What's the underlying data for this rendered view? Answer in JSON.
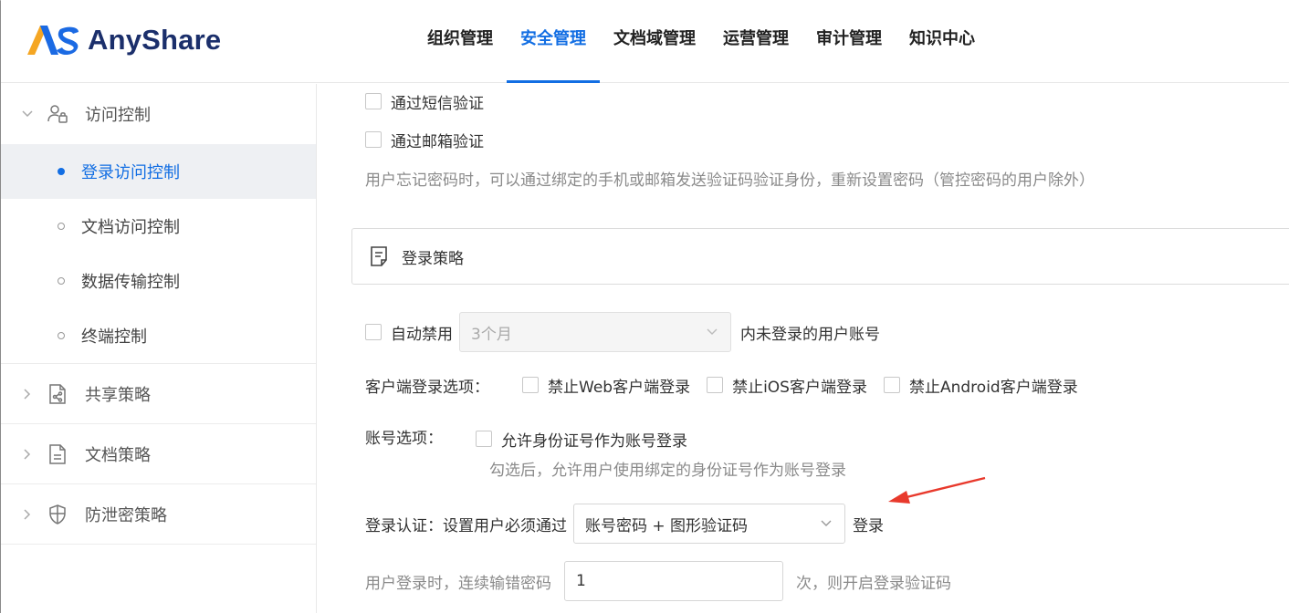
{
  "brand": {
    "name": "AnyShare",
    "logo_color_a": "#1b6ae3",
    "logo_color_b": "#f5a623"
  },
  "nav": {
    "items": [
      {
        "label": "组织管理"
      },
      {
        "label": "安全管理",
        "active": true
      },
      {
        "label": "文档域管理"
      },
      {
        "label": "运营管理"
      },
      {
        "label": "审计管理"
      },
      {
        "label": "知识中心"
      }
    ],
    "accent": "#126ee3"
  },
  "sidebar": {
    "groups": [
      {
        "label": "访问控制",
        "icon": "users-icon",
        "expanded": true,
        "items": [
          {
            "label": "登录访问控制",
            "active": true
          },
          {
            "label": "文档访问控制"
          },
          {
            "label": "数据传输控制"
          },
          {
            "label": "终端控制"
          }
        ]
      },
      {
        "label": "共享策略",
        "icon": "share-doc-icon"
      },
      {
        "label": "文档策略",
        "icon": "doc-icon"
      },
      {
        "label": "防泄密策略",
        "icon": "shield-icon"
      }
    ]
  },
  "main": {
    "reset": {
      "sms_label": "通过短信验证",
      "email_label": "通过邮箱验证",
      "hint": "用户忘记密码时，可以通过绑定的手机或邮箱发送验证码验证身份，重新设置密码（管控密码的用户除外）"
    },
    "panel_title": "登录策略",
    "auto_disable": {
      "label": "自动禁用",
      "select_value": "3个月",
      "suffix": "内未登录的用户账号"
    },
    "client_options": {
      "label": "客户端登录选项：",
      "web": "禁止Web客户端登录",
      "ios": "禁止iOS客户端登录",
      "android": "禁止Android客户端登录"
    },
    "account_options": {
      "label": "账号选项：",
      "id_login": "允许身份证号作为账号登录",
      "hint": "勾选后，允许用户使用绑定的身份证号作为账号登录"
    },
    "auth": {
      "label": "登录认证：设置用户必须通过",
      "select_value": "账号密码 + 图形验证码",
      "suffix": "登录"
    },
    "captcha": {
      "prefix": "用户登录时，连续输错密码",
      "value": "1",
      "suffix": "次，则开启登录验证码"
    }
  }
}
